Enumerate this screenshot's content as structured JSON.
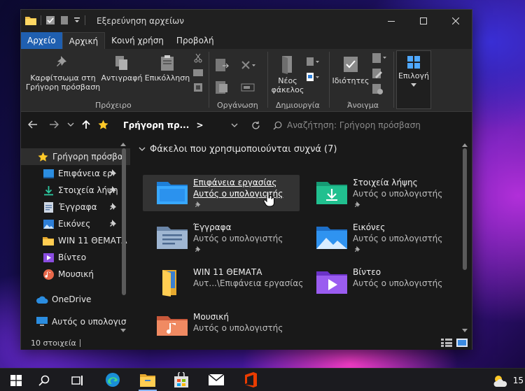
{
  "window": {
    "title": "Εξερεύνηση αρχείων",
    "controls": [
      "minimize",
      "maximize",
      "close"
    ]
  },
  "ribbon_tabs": [
    {
      "label": "Αρχείο"
    },
    {
      "label": "Αρχική"
    },
    {
      "label": "Κοινή χρήση"
    },
    {
      "label": "Προβολή"
    }
  ],
  "ribbon": {
    "pin_label": "Καρφίτσωμα στη\nΓρήγορη πρόσβαση",
    "copy_label": "Αντιγραφή",
    "paste_label": "Επικόλληση",
    "new_folder_label": "Νέος\nφάκελος",
    "properties_label": "Ιδιότητες",
    "select_label": "Επιλογή",
    "groups": {
      "clipboard": "Πρόχειρο",
      "organize": "Οργάνωση",
      "new": "Δημιουργία",
      "open": "Άνοιγμα"
    }
  },
  "address": {
    "path": "Γρήγορη πρ...",
    "separator": ">",
    "search_placeholder": "Αναζήτηση: Γρήγορη πρόσβαση"
  },
  "sidebar": {
    "items": [
      {
        "label": "Γρήγορη πρόσβα",
        "icon": "star-icon"
      },
      {
        "label": "Επιφάνεια ερ",
        "icon": "desktop-icon",
        "pinned": true
      },
      {
        "label": "Στοιχεία λήψη",
        "icon": "download-icon",
        "pinned": true
      },
      {
        "label": "Έγγραφα",
        "icon": "document-icon",
        "pinned": true
      },
      {
        "label": "Εικόνες",
        "icon": "pictures-icon",
        "pinned": true
      },
      {
        "label": "WIN 11 ΘΕΜΑΤΑ",
        "icon": "folder-icon"
      },
      {
        "label": "Βίντεο",
        "icon": "video-icon"
      },
      {
        "label": "Μουσική",
        "icon": "music-icon"
      },
      {
        "label": "OneDrive",
        "icon": "cloud-icon"
      },
      {
        "label": "Αυτός ο υπολογισ",
        "icon": "computer-icon"
      }
    ]
  },
  "content": {
    "section_title": "Φάκελοι που χρησιμοποιούνται συχνά (7)",
    "folders": [
      {
        "name": "Επιφάνεια εργασίας",
        "location": "Αυτός ο υπολογιστής",
        "pinned": true,
        "icon": "desktop-folder-icon"
      },
      {
        "name": "Στοιχεία λήψης",
        "location": "Αυτός ο υπολογιστής",
        "pinned": true,
        "icon": "downloads-folder-icon"
      },
      {
        "name": "Έγγραφα",
        "location": "Αυτός ο υπολογιστής",
        "pinned": true,
        "icon": "documents-folder-icon"
      },
      {
        "name": "Εικόνες",
        "location": "Αυτός ο υπολογιστής",
        "pinned": true,
        "icon": "pictures-folder-icon"
      },
      {
        "name": "WIN 11 ΘΕΜΑΤΑ",
        "location": "Αυτ...\\Επιφάνεια εργασίας",
        "pinned": false,
        "icon": "folder-icon"
      },
      {
        "name": "Βίντεο",
        "location": "Αυτός ο υπολογιστής",
        "pinned": false,
        "icon": "videos-folder-icon"
      },
      {
        "name": "Μουσική",
        "location": "Αυτός ο υπολογιστής",
        "pinned": false,
        "icon": "music-folder-icon"
      }
    ]
  },
  "status": {
    "count": "10 στοιχεία"
  },
  "taskbar": {
    "time": "15"
  },
  "colors": {
    "accent": "#1f5fb0",
    "window_bg": "#191919",
    "ribbon_bg": "#2b2b2b"
  }
}
